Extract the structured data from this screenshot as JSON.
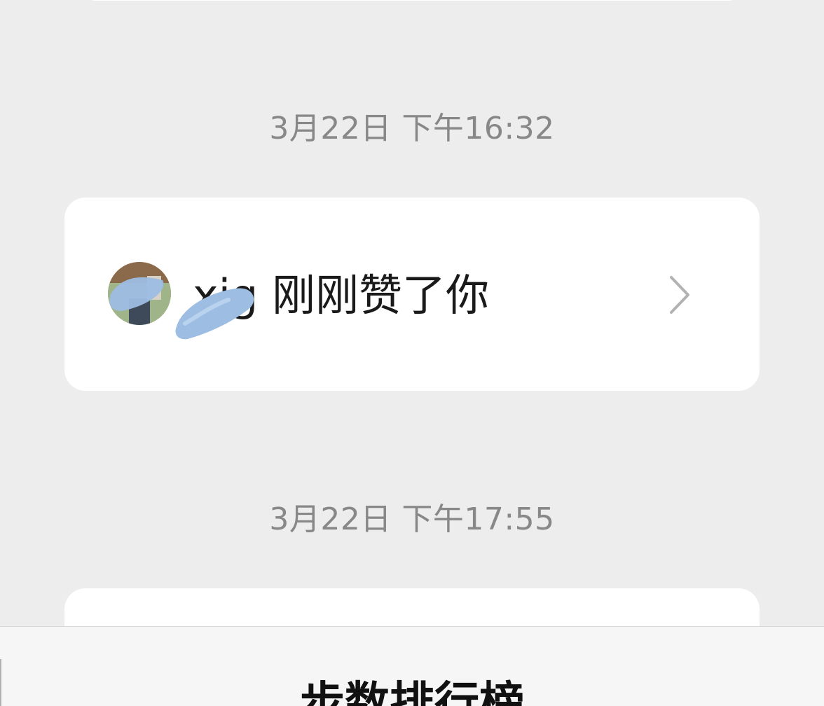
{
  "feed": {
    "items": [
      {
        "timestamp": "3月22日 下午16:32",
        "sender_name": "xjg",
        "message": "刚刚赞了你",
        "avatar_icon": "user-avatar-icon",
        "chevron_icon": "chevron-right-icon"
      },
      {
        "timestamp": "3月22日 下午17:55"
      }
    ]
  },
  "sheet": {
    "title": "步数排行榜"
  },
  "colors": {
    "background": "#ededed",
    "card": "#ffffff",
    "timestamp_text": "#888888",
    "message_text": "#1a1a1a",
    "chevron": "#b2b2b2",
    "redaction_mark": "#9dbde3"
  }
}
